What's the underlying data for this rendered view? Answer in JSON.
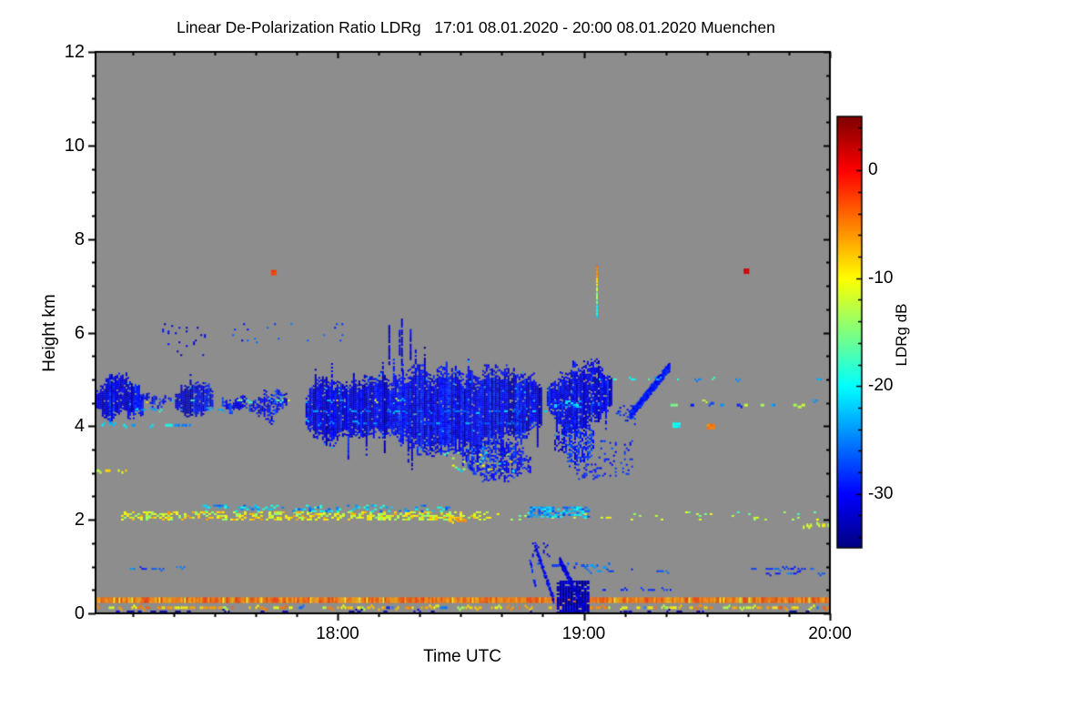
{
  "chart_data": {
    "type": "heatmap",
    "title": "Linear De-Polarization Ratio LDRg   17:01 08.01.2020 - 20:00 08.01.2020 Muenchen",
    "xlabel": "Time UTC",
    "ylabel": "Height km",
    "station": "Muenchen",
    "time_span": {
      "start": "17:01 08.01.2020",
      "end": "20:00 08.01.2020"
    },
    "x_axis": {
      "range_hours": [
        17.0167,
        20.0
      ],
      "ticks": [
        {
          "hours": 18,
          "label": "18:00"
        },
        {
          "hours": 19,
          "label": "19:00"
        },
        {
          "hours": 20,
          "label": "20:00"
        }
      ],
      "minor_step_hours": 0.16667
    },
    "y_axis": {
      "range_km": [
        0,
        12
      ],
      "ticks": [
        {
          "km": 0,
          "label": "0"
        },
        {
          "km": 2,
          "label": "2"
        },
        {
          "km": 4,
          "label": "4"
        },
        {
          "km": 6,
          "label": "6"
        },
        {
          "km": 8,
          "label": "8"
        },
        {
          "km": 10,
          "label": "10"
        },
        {
          "km": 12,
          "label": "12"
        }
      ],
      "minor_step_km": 0.5
    },
    "colorbar": {
      "label": "LDRg dB",
      "range_db": [
        -35,
        5
      ],
      "ticks": [
        {
          "db": 0,
          "label": "0"
        },
        {
          "db": -10,
          "label": "-10"
        },
        {
          "db": -20,
          "label": "-20"
        },
        {
          "db": -30,
          "label": "-30"
        }
      ],
      "minor_step_db": 2,
      "colormap": "jet"
    },
    "no_signal_color": "#8d8d8d",
    "features": [
      {
        "kind": "cloud",
        "name": "cloud-a",
        "t": [
          17.02,
          17.21
        ],
        "hb": 4.2,
        "ht": 5.1,
        "jit": 0.18,
        "spike_dn": 0.4,
        "density": 0.96,
        "v": [
          -33,
          -28
        ]
      },
      {
        "kind": "cloud",
        "name": "cloud-a-tail",
        "t": [
          17.2,
          17.33
        ],
        "hb": 4.45,
        "ht": 4.72,
        "jit": 0.08,
        "density": 0.55,
        "v": [
          -32,
          -27
        ]
      },
      {
        "kind": "cloud",
        "name": "cloud-b",
        "t": [
          17.34,
          17.49
        ],
        "hb": 4.32,
        "ht": 4.98,
        "jit": 0.15,
        "spike_up": 0.3,
        "density": 0.93,
        "v": [
          -33,
          -28
        ]
      },
      {
        "kind": "dots",
        "name": "dots-above-b",
        "t": [
          17.28,
          17.47
        ],
        "h": [
          5.5,
          6.2
        ],
        "density": 0.05,
        "v": [
          -33,
          -29
        ],
        "cell": 2
      },
      {
        "kind": "dots",
        "name": "dots-6km-left",
        "t": [
          17.55,
          18.02
        ],
        "h": [
          5.8,
          6.2
        ],
        "density": 0.03,
        "v": [
          -31,
          -24
        ],
        "cell": 2
      },
      {
        "kind": "cloud",
        "name": "cloud-c1",
        "t": [
          17.53,
          17.63
        ],
        "hb": 4.2,
        "ht": 4.68,
        "jit": 0.12,
        "density": 0.8,
        "v": [
          -32,
          -27
        ]
      },
      {
        "kind": "cloud",
        "name": "cloud-c2",
        "t": [
          17.64,
          17.79
        ],
        "hb": 4.18,
        "ht": 4.72,
        "jit": 0.14,
        "density": 0.72,
        "v": [
          -32,
          -27
        ]
      },
      {
        "kind": "cloud",
        "name": "cloud-main",
        "t": [
          17.87,
          18.83
        ],
        "hb": 3.6,
        "ht": 5.1,
        "jit": 0.22,
        "spike_up": 0.45,
        "spike_dn": 0.55,
        "density": 0.97,
        "v": [
          -33,
          -28
        ]
      },
      {
        "kind": "cloud",
        "name": "cloud-main-low",
        "t": [
          18.52,
          18.78
        ],
        "hb": 2.95,
        "ht": 3.7,
        "jit": 0.15,
        "density": 0.6,
        "v": [
          -32,
          -27
        ]
      },
      {
        "kind": "cloud",
        "name": "cloud-e",
        "t": [
          18.85,
          19.11
        ],
        "hb": 4.0,
        "ht": 5.25,
        "jit": 0.2,
        "spike_dn": 0.5,
        "density": 0.92,
        "v": [
          -33,
          -28
        ]
      },
      {
        "kind": "cloud",
        "name": "cloud-e-tail",
        "t": [
          18.88,
          19.04
        ],
        "hb": 3.25,
        "ht": 4.05,
        "jit": 0.15,
        "density": 0.5,
        "v": [
          -32,
          -27
        ]
      },
      {
        "kind": "dots",
        "name": "blob-below-e",
        "t": [
          18.97,
          19.07
        ],
        "h": [
          2.85,
          3.2
        ],
        "density": 0.3,
        "v": [
          -31,
          -27
        ],
        "cell": 2
      },
      {
        "kind": "dots",
        "name": "dots-below-e-right",
        "t": [
          19.06,
          19.2
        ],
        "h": [
          2.95,
          3.7
        ],
        "density": 0.1,
        "v": [
          -31,
          -27
        ],
        "cell": 2
      },
      {
        "kind": "dots",
        "name": "fringe-e-right",
        "t": [
          19.13,
          19.21
        ],
        "h": [
          4.05,
          4.45
        ],
        "density": 0.25,
        "v": [
          -32,
          -27
        ],
        "cell": 2
      },
      {
        "kind": "needles",
        "name": "streaks-above-main",
        "t": [
          18.19,
          18.31
        ],
        "h": [
          5.15,
          6.3
        ],
        "count": 4,
        "v": [
          -34,
          -29
        ]
      },
      {
        "kind": "diag",
        "name": "streak-1920",
        "p0": [
          19.185,
          4.25
        ],
        "p1": [
          19.345,
          5.3
        ],
        "thick": 0.2,
        "density": 0.85,
        "v": [
          -32,
          -27
        ]
      },
      {
        "kind": "vstreak",
        "name": "colored-streak-1903",
        "t": 19.05,
        "h": [
          6.35,
          7.45
        ],
        "v": [
          -22,
          -4
        ]
      },
      {
        "kind": "dots",
        "name": "dot-darkred",
        "t": [
          19.65,
          19.67
        ],
        "h": [
          7.3,
          7.37
        ],
        "density": 1,
        "v": [
          1,
          2
        ],
        "cell": 3
      },
      {
        "kind": "dots",
        "name": "dot-red-1744",
        "t": [
          17.73,
          17.75
        ],
        "h": [
          7.27,
          7.34
        ],
        "density": 1,
        "v": [
          -3,
          -2
        ],
        "cell": 3
      },
      {
        "kind": "row",
        "name": "speckle-row-4.55",
        "t": [
          17.0,
          19.98
        ],
        "h": 4.55,
        "th": 2,
        "density": 0.07,
        "v": [
          -24,
          -9
        ]
      },
      {
        "kind": "row",
        "name": "speckle-row-5.0-right",
        "t": [
          19.05,
          19.99
        ],
        "h": 5.0,
        "th": 2,
        "density": 0.13,
        "v": [
          -26,
          -17
        ]
      },
      {
        "kind": "row",
        "name": "speckle-row-4.45-right",
        "t": [
          19.33,
          19.92
        ],
        "h": 4.45,
        "th": 3,
        "density": 0.3,
        "v": [
          -17,
          -8
        ],
        "cold": 0.3
      },
      {
        "kind": "row",
        "name": "speckle-row-4.35-left",
        "t": [
          17.0,
          17.6
        ],
        "h": 4.35,
        "th": 2,
        "density": 0.15,
        "v": [
          -24,
          -18
        ]
      },
      {
        "kind": "row",
        "name": "speckle-row-4.0-left",
        "t": [
          17.03,
          17.4
        ],
        "h": 4.02,
        "th": 3,
        "density": 0.35,
        "v": [
          -26,
          -19
        ]
      },
      {
        "kind": "row",
        "name": "cloud-inner-bright-row1",
        "t": [
          17.9,
          18.85
        ],
        "h": 4.32,
        "th": 2,
        "density": 0.4,
        "v": [
          -27,
          -21
        ]
      },
      {
        "kind": "row",
        "name": "cloud-inner-bright-row2",
        "t": [
          17.92,
          18.8
        ],
        "h": 4.06,
        "th": 2,
        "density": 0.3,
        "v": [
          -28,
          -22
        ]
      },
      {
        "kind": "band",
        "name": "cyan-patch-in-e",
        "t": [
          18.88,
          18.98
        ],
        "h": [
          4.4,
          4.55
        ],
        "density": 0.5,
        "v": [
          -27,
          -20
        ]
      },
      {
        "kind": "band",
        "name": "aerosol-2km-dense",
        "t": [
          17.12,
          18.58
        ],
        "h": [
          2.0,
          2.18
        ],
        "density": 0.5,
        "v": [
          -15,
          -6
        ]
      },
      {
        "kind": "band",
        "name": "aerosol-2km-sparse",
        "t": [
          18.58,
          19.98
        ],
        "h": [
          2.0,
          2.18
        ],
        "density": 0.07,
        "v": [
          -18,
          -9
        ]
      },
      {
        "kind": "band",
        "name": "aerosol-cyan-band",
        "t": [
          17.45,
          18.45
        ],
        "h": [
          2.18,
          2.32
        ],
        "density": 0.3,
        "v": [
          -27,
          -17
        ]
      },
      {
        "kind": "band",
        "name": "aerosol-cyan-1900",
        "t": [
          18.77,
          19.02
        ],
        "h": [
          2.08,
          2.28
        ],
        "density": 0.55,
        "v": [
          -28,
          -19
        ]
      },
      {
        "kind": "row",
        "name": "dash-orange-1828",
        "t": [
          18.45,
          18.52
        ],
        "h": 1.98,
        "th": 3,
        "density": 0.9,
        "v": [
          -9,
          -4
        ]
      },
      {
        "kind": "row",
        "name": "dash-yellow-right-edge",
        "t": [
          19.89,
          19.99
        ],
        "h": 1.88,
        "th": 4,
        "density": 0.95,
        "v": [
          -13,
          -8
        ]
      },
      {
        "kind": "band",
        "name": "below-cloud-speckle",
        "t": [
          18.42,
          18.72
        ],
        "h": [
          3.0,
          3.45
        ],
        "density": 0.09,
        "v": [
          -22,
          -8
        ]
      },
      {
        "kind": "row",
        "name": "yellow-left-3km",
        "t": [
          17.0,
          17.14
        ],
        "h": 3.05,
        "th": 3,
        "density": 0.5,
        "v": [
          -13,
          -8
        ]
      },
      {
        "kind": "dots",
        "name": "dot-cyan-1937",
        "t": [
          19.36,
          19.39
        ],
        "h": [
          4.0,
          4.08
        ],
        "density": 1,
        "v": [
          -21,
          -19
        ],
        "cell": 3
      },
      {
        "kind": "dots",
        "name": "dot-orange-1952",
        "t": [
          19.5,
          19.53
        ],
        "h": [
          3.98,
          4.05
        ],
        "density": 1,
        "v": [
          -6,
          -4
        ],
        "cell": 3
      },
      {
        "kind": "solidrow",
        "name": "strong-echo-line-0.3km",
        "t": [
          17.0,
          19.99
        ],
        "h": [
          0.24,
          0.34
        ],
        "v": [
          -7,
          -2
        ]
      },
      {
        "kind": "row",
        "name": "low-level-speckle-0.1km",
        "t": [
          17.0,
          19.99
        ],
        "h": 0.12,
        "th": 3,
        "density": 0.5,
        "v": [
          -13,
          -4
        ],
        "cold": 0.1
      },
      {
        "kind": "row",
        "name": "ground-dark-dots",
        "t": [
          17.0,
          19.99
        ],
        "h": 0.04,
        "th": 2,
        "density": 0.15,
        "v": [
          -35,
          -31
        ]
      },
      {
        "kind": "row",
        "name": "blue-1km-left",
        "t": [
          17.1,
          17.38
        ],
        "h": 0.95,
        "th": 2,
        "density": 0.25,
        "v": [
          -30,
          -24
        ]
      },
      {
        "kind": "row",
        "name": "blue-1km-mid",
        "t": [
          18.8,
          19.1
        ],
        "h": 1.02,
        "th": 3,
        "density": 0.35,
        "v": [
          -30,
          -23
        ]
      },
      {
        "kind": "row",
        "name": "blue-0.9km-mid",
        "t": [
          19.0,
          19.35
        ],
        "h": 0.9,
        "th": 2,
        "density": 0.3,
        "v": [
          -30,
          -24
        ]
      },
      {
        "kind": "row",
        "name": "blue-1km-right",
        "t": [
          19.68,
          19.97
        ],
        "h": 0.95,
        "th": 2,
        "density": 0.45,
        "v": [
          -30,
          -24
        ]
      },
      {
        "kind": "row",
        "name": "blue-0.85km-right",
        "t": [
          19.74,
          19.99
        ],
        "h": 0.85,
        "th": 2,
        "density": 0.4,
        "v": [
          -30,
          -24
        ]
      },
      {
        "kind": "diag",
        "name": "fall-streak-1",
        "p0": [
          18.8,
          1.45
        ],
        "p1": [
          18.875,
          0.3
        ],
        "thick": 0.14,
        "density": 0.7,
        "v": [
          -33,
          -28
        ]
      },
      {
        "kind": "diag",
        "name": "fall-streak-2",
        "p0": [
          18.9,
          1.15
        ],
        "p1": [
          19.0,
          0.12
        ],
        "thick": 0.18,
        "density": 0.75,
        "v": [
          -34,
          -29
        ]
      },
      {
        "kind": "diag",
        "name": "fall-arc-left",
        "p0": [
          18.775,
          1.25
        ],
        "p1": [
          18.8,
          0.6
        ],
        "thick": 0.08,
        "density": 0.4,
        "v": [
          -32,
          -27
        ]
      },
      {
        "kind": "dots",
        "name": "fall-top-dots",
        "t": [
          18.79,
          18.86
        ],
        "h": [
          1.2,
          1.55
        ],
        "density": 0.15,
        "v": [
          -33,
          -29
        ],
        "cell": 2
      },
      {
        "kind": "band",
        "name": "fall-dense-core",
        "t": [
          18.89,
          19.02
        ],
        "h": [
          0.02,
          0.7
        ],
        "density": 0.85,
        "v": [
          -35,
          -31
        ]
      },
      {
        "kind": "row",
        "name": "fall-right-speckle",
        "t": [
          19.02,
          19.35
        ],
        "h": 0.5,
        "th": 2,
        "density": 0.2,
        "v": [
          -32,
          -27
        ]
      }
    ]
  }
}
